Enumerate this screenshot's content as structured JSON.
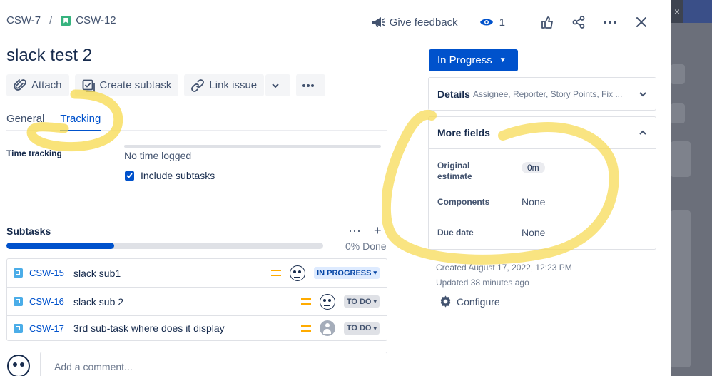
{
  "breadcrumb": {
    "parent": "CSW-7",
    "separator": "/",
    "current": "CSW-12"
  },
  "topbar": {
    "feedback": "Give feedback",
    "watch_count": "1"
  },
  "issue": {
    "title": "slack test 2"
  },
  "toolbar": {
    "attach": "Attach",
    "create_subtask": "Create subtask",
    "link_issue": "Link issue"
  },
  "tabs": [
    {
      "label": "General"
    },
    {
      "label": "Tracking"
    }
  ],
  "tracking": {
    "label": "Time tracking",
    "value": "No time logged",
    "include_subtasks": "Include subtasks"
  },
  "subtasks": {
    "title": "Subtasks",
    "progress": 0.34,
    "done_text": "0% Done",
    "rows": [
      {
        "key": "CSW-15",
        "summary": "slack sub1",
        "status": "IN PROGRESS"
      },
      {
        "key": "CSW-16",
        "summary": "slack sub 2",
        "status": "TO DO"
      },
      {
        "key": "CSW-17",
        "summary": "3rd sub-task where does it display",
        "status": "TO DO"
      }
    ]
  },
  "comment": {
    "placeholder": "Add a comment..."
  },
  "sidebar": {
    "status": "In Progress",
    "details_title": "Details",
    "details_summary": "Assignee, Reporter, Story Points, Fix ...",
    "more_title": "More fields",
    "fields": [
      {
        "label": "Original\nestimate",
        "value": "0m"
      },
      {
        "label": "Components",
        "value": "None"
      },
      {
        "label": "Due date",
        "value": "None"
      }
    ],
    "created": "Created August 17, 2022, 12:23 PM",
    "updated": "Updated 38 minutes ago",
    "configure": "Configure"
  },
  "colors": {
    "accent": "#0052CC",
    "highlighter": "#F7D94C"
  }
}
